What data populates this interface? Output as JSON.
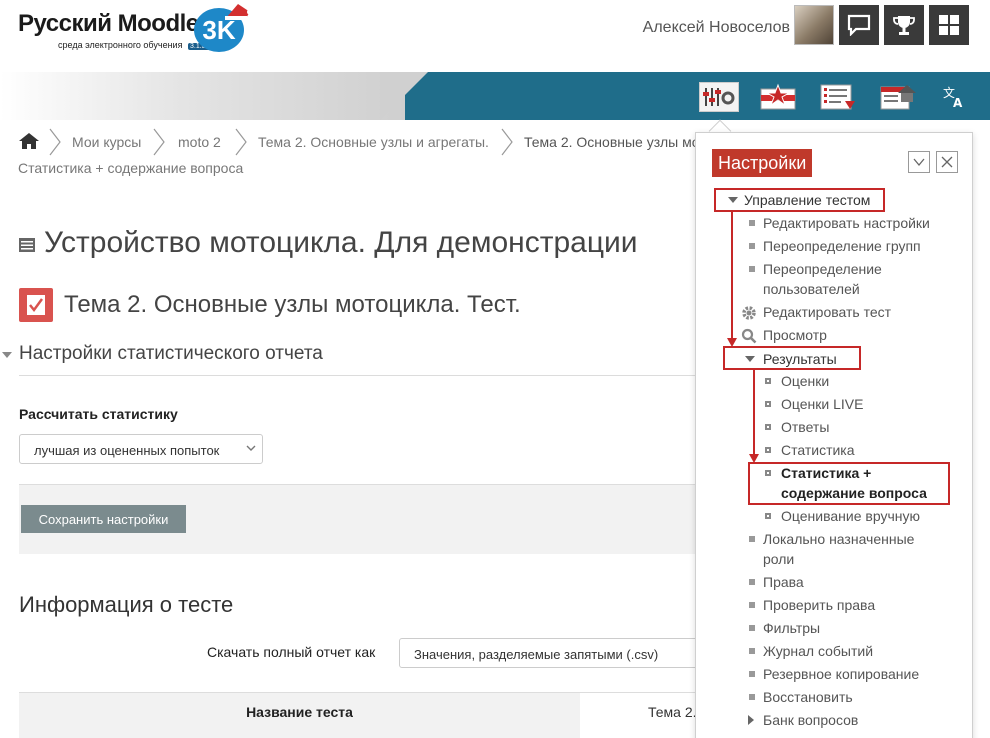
{
  "header": {
    "logo_title": "Русский Moodle",
    "logo_subtitle": "среда электронного обучения",
    "logo_version": "3.1.3b",
    "logo_badge": "3K",
    "user_name": "Алексей Новоселов",
    "header_buttons": [
      "messages-icon",
      "trophy-icon",
      "apps-grid-icon"
    ]
  },
  "navbar": {
    "icons": [
      "settings-sliders-icon",
      "star-certificate-icon",
      "gradebook-list-icon",
      "course-home-icon",
      "translate-icon"
    ]
  },
  "breadcrumb": {
    "home_icon": "home-icon",
    "items": [
      "Мои курсы",
      "moto 2",
      "Тема 2. Основные узлы и агрегаты.",
      "Тема 2. Основные узлы мо"
    ],
    "line2": "Статистика + содержание вопроса"
  },
  "main": {
    "course_title": "Устройство мотоцикла. Для демонстрации",
    "quiz_title": "Тема 2. Основные узлы мотоцикла. Тест.",
    "section_title": "Настройки статистического отчета",
    "stat_label": "Рассчитать статистику",
    "stat_select_value": "лучшая из оцененных попыток",
    "save_button": "Сохранить настройки",
    "info_title": "Информация о тесте",
    "download_label": "Скачать полный отчет как",
    "download_select_value": "Значения, разделяемые запятыми (.csv)",
    "table_header": "Название теста",
    "table_value": "Тема 2."
  },
  "settings_popup": {
    "title": "Настройки",
    "quiz_admin": "Управление тестом",
    "admin_items": [
      "Редактировать настройки",
      "Переопределение групп",
      "Переопределение",
      "пользователей",
      "Редактировать тест",
      "Просмотр"
    ],
    "results": "Результаты",
    "result_items": [
      "Оценки",
      "Оценки LIVE",
      "Ответы",
      "Статистика"
    ],
    "highlighted_item_line1": "Статистика +",
    "highlighted_item_line2": "содержание вопроса",
    "manual_grading": "Оценивание вручную",
    "more_items": [
      "Локально назначенные",
      "роли",
      "Права",
      "Проверить права",
      "Фильтры",
      "Журнал событий",
      "Резервное копирование",
      "Восстановить",
      "Банк вопросов"
    ]
  },
  "colors": {
    "accent_red": "#c62828",
    "popup_title_bg": "#c0392b",
    "nav_teal": "#1f6d8a",
    "save_button_bg": "#7b8b8e"
  }
}
